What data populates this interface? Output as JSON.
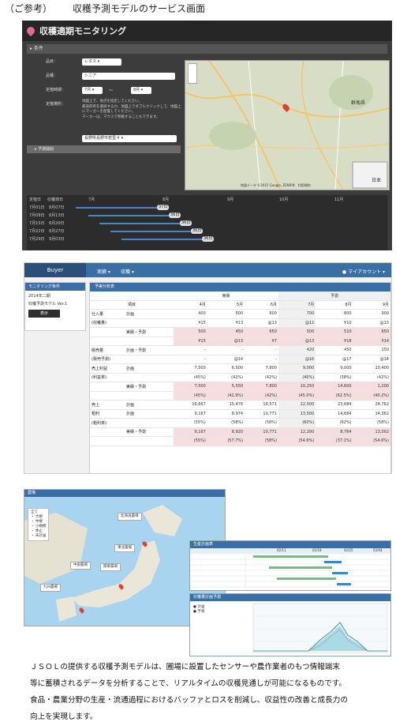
{
  "heading": {
    "prefix": "（ご参考）",
    "title": "収穫予測モデルのサービス画面"
  },
  "screen1": {
    "app_title": "収穫適期モニタリング",
    "cond_label": "条件",
    "item_label": "品目：",
    "item_value": "レタス",
    "variety_label": "品種：",
    "variety_value": "シニア",
    "period_label": "定植時期：",
    "period_from": "7月",
    "period_sep": "〜",
    "period_to": "8月",
    "place_label": "定植場所：",
    "notes": [
      "地図上で、地点を指定してください。",
      "都道府県を選択するか、地図上でダブルクリックして、地図上にマーカーを配置してください。",
      "マーカーは、マウスで移動することもできます。"
    ],
    "place_value": "長野県長野市若里４",
    "predict_button": "予測開始",
    "map_labels": [
      "群馬県",
      "日本"
    ],
    "map_attribution": "地図データ ©2015 Google, ZENRIN　利用規約",
    "timeline_head": [
      "定植日",
      "収穫適日",
      "7月",
      "8月",
      "9月",
      "10月",
      "11月"
    ],
    "timeline_rows": [
      {
        "plant": "7月01日",
        "harvest": "8月07日",
        "days": "37日"
      },
      {
        "plant": "7月08日",
        "harvest": "8月13日",
        "days": "36日"
      },
      {
        "plant": "7月15日",
        "harvest": "8月20日",
        "days": "36日"
      },
      {
        "plant": "7月22日",
        "harvest": "8月27日",
        "days": "36日"
      },
      {
        "plant": "7月29日",
        "harvest": "9月03日",
        "days": "36日"
      }
    ]
  },
  "screen2": {
    "brand": "Buyer",
    "menu1": "実績 ▾",
    "menu2": "収穫 ▾",
    "account": "マイアカウント ▾",
    "side_header": "モニタリング条件",
    "side_items": [
      "2014年二期",
      "収穫予測モデル Ver.1"
    ],
    "side_button": "表示",
    "panel_header": "予実分析表",
    "group_actual": "実績",
    "group_plan": "予測",
    "col_item": "項目",
    "months": [
      "4月",
      "5月",
      "6月",
      "7月",
      "8月",
      "9月"
    ],
    "rows": [
      {
        "g": "仕入量",
        "s": "計画",
        "v": [
          "400",
          "500",
          "600",
          "700",
          "800",
          "900"
        ],
        "pink": false
      },
      {
        "g": "(収穫量)",
        "s": "",
        "v": [
          "¥15",
          "¥13",
          "@13",
          "@12",
          "¥10",
          "@13"
        ],
        "pink": false
      },
      {
        "g": "",
        "s": "実績・予測",
        "v": [
          "500",
          "450",
          "650",
          "500",
          "510",
          "650"
        ],
        "pink": true
      },
      {
        "g": "",
        "s": "",
        "v": [
          "¥15",
          "@13",
          "¥7",
          "@13",
          "¥18",
          "¥14"
        ],
        "pink": true
      },
      {
        "g": "販売量",
        "s": "計画・予測",
        "v": [
          "-",
          "-",
          "-",
          "420",
          "450",
          "150"
        ],
        "pink": false
      },
      {
        "g": "(販売予測)",
        "s": "",
        "v": [
          "-",
          "@14",
          "-",
          "@16",
          "@17",
          "@14"
        ],
        "pink": false
      },
      {
        "g": "売上利益",
        "s": "計画",
        "v": [
          "7,500",
          "6,500",
          "7,800",
          "9,000",
          "9,000",
          "10,400"
        ],
        "pink": false
      },
      {
        "g": "(利益率)",
        "s": "",
        "v": [
          "(45%)",
          "(42%)",
          "(42%)",
          "(40%)",
          "(38%)",
          "(42%)"
        ],
        "pink": false
      },
      {
        "g": "",
        "s": "実績・予測",
        "v": [
          "7,500",
          "5,550",
          "7,800",
          "10,250",
          "14,600",
          "1,200"
        ],
        "pink": true
      },
      {
        "g": "",
        "s": "",
        "v": [
          "(45%)",
          "(42.9%)",
          "(42%)",
          "(45.0%)",
          "(62.5%)",
          "(40.2%)"
        ],
        "pink": true
      },
      {
        "g": "売上",
        "s": "計画",
        "v": [
          "16,667",
          "15,476",
          "18,571",
          "22,500",
          "23,684",
          "24,762"
        ],
        "pink": false
      },
      {
        "g": "粗利",
        "s": "計画",
        "v": [
          "9,167",
          "8,974",
          "10,771",
          "13,500",
          "14,684",
          "14,362"
        ],
        "pink": false
      },
      {
        "g": "(粗利率)",
        "s": "",
        "v": [
          "(55%)",
          "(58%)",
          "(58%)",
          "(60%)",
          "(62%)",
          "(58%)"
        ],
        "pink": false
      },
      {
        "g": "",
        "s": "実績・予測",
        "v": [
          "9,167",
          "8,920",
          "10,771",
          "12,200",
          "8,764",
          "13,002"
        ],
        "pink": true
      },
      {
        "g": "",
        "s": "",
        "v": [
          "(55%)",
          "(57.7%)",
          "(58%)",
          "(54.6%)",
          "(37.1%)",
          "(54.6%)"
        ],
        "pink": true
      }
    ]
  },
  "screen3": {
    "title": "農場",
    "legend": [
      "全て",
      "・ 大規",
      "・ 中規",
      "・ 小規模",
      "・ 休止",
      "・ 未計画"
    ],
    "farms": [
      "北海道農場",
      "東北農場",
      "中部農場",
      "関東農場",
      "九州農場"
    ]
  },
  "screen4": {
    "title": "生産計画表",
    "cols": [
      "02/11",
      "02/18",
      "02/25",
      "03/04"
    ]
  },
  "screen5": {
    "title": "収穫量計画予測",
    "legend": [
      "計画",
      "予測"
    ]
  },
  "paragraph": [
    "ＪＳＯＬの提供する収穫予測モデルは、圃場に設置したセンサーや農作業者のもつ情報端末",
    "等に蓄積されるデータを分析することで、リアルタイムの収穫見通しが可能になるものです。",
    "食品・農業分野の生産・流通過程におけるバッファとロスを削減し、収益性の改善と成長力の",
    "向上を実現します。"
  ]
}
